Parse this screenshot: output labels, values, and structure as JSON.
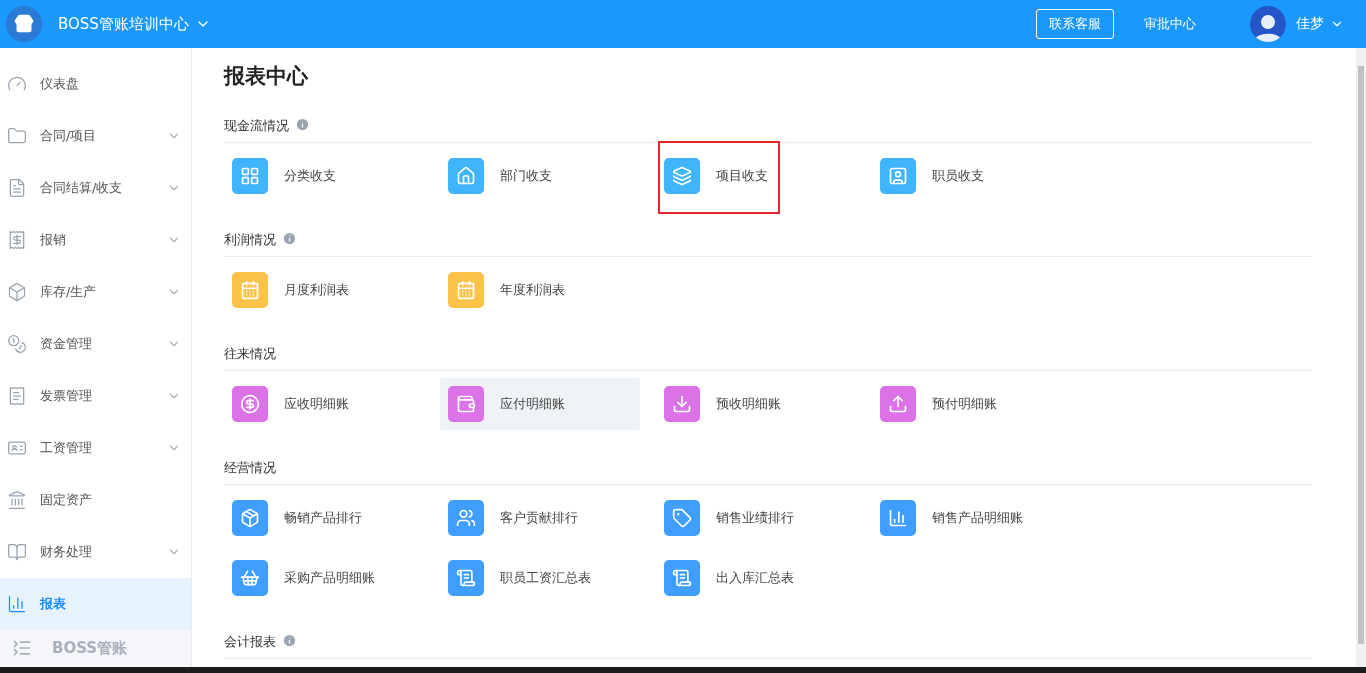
{
  "header": {
    "company": "BOSS管账培训中心",
    "support_button": "联系客服",
    "approval_link": "审批中心",
    "user_name": "佳梦"
  },
  "sidebar": {
    "items": [
      {
        "label": "仪表盘",
        "kind": "gauge",
        "expandable": false,
        "selected": false
      },
      {
        "label": "合同/项目",
        "kind": "folder",
        "expandable": true,
        "selected": false
      },
      {
        "label": "合同结算/收支",
        "kind": "settle",
        "expandable": true,
        "selected": false
      },
      {
        "label": "报销",
        "kind": "reimburse",
        "expandable": true,
        "selected": false
      },
      {
        "label": "库存/生产",
        "kind": "box",
        "expandable": true,
        "selected": false
      },
      {
        "label": "资金管理",
        "kind": "coins",
        "expandable": true,
        "selected": false
      },
      {
        "label": "发票管理",
        "kind": "receipt",
        "expandable": true,
        "selected": false
      },
      {
        "label": "工资管理",
        "kind": "card",
        "expandable": true,
        "selected": false
      },
      {
        "label": "固定资产",
        "kind": "asset",
        "expandable": false,
        "selected": false
      },
      {
        "label": "财务处理",
        "kind": "ledger",
        "expandable": true,
        "selected": false
      },
      {
        "label": "报表",
        "kind": "chart",
        "expandable": false,
        "selected": true
      }
    ],
    "footer": "BOSS管账"
  },
  "page": {
    "title": "报表中心",
    "sections": [
      {
        "heading": "现金流情况",
        "info": true,
        "color": "#40b5fc",
        "items": [
          {
            "label": "分类收支",
            "kind": "grid",
            "selected": false,
            "marked": false
          },
          {
            "label": "部门收支",
            "kind": "home",
            "selected": false,
            "marked": false
          },
          {
            "label": "项目收支",
            "kind": "layers",
            "selected": false,
            "marked": true
          },
          {
            "label": "职员收支",
            "kind": "person",
            "selected": false,
            "marked": false
          }
        ]
      },
      {
        "heading": "利润情况",
        "info": true,
        "color": "#fcc24a",
        "items": [
          {
            "label": "月度利润表",
            "kind": "calendar",
            "selected": false,
            "marked": false
          },
          {
            "label": "年度利润表",
            "kind": "calendar",
            "selected": false,
            "marked": false
          }
        ]
      },
      {
        "heading": "往来情况",
        "info": false,
        "color": "#db72e8",
        "items": [
          {
            "label": "应收明细账",
            "kind": "moneybag",
            "selected": false,
            "marked": false
          },
          {
            "label": "应付明细账",
            "kind": "wallet",
            "selected": true,
            "marked": false
          },
          {
            "label": "预收明细账",
            "kind": "download",
            "selected": false,
            "marked": false
          },
          {
            "label": "预付明细账",
            "kind": "upload",
            "selected": false,
            "marked": false
          }
        ]
      },
      {
        "heading": "经营情况",
        "info": false,
        "color": "#409eff",
        "items": [
          {
            "label": "畅销产品排行",
            "kind": "box",
            "selected": false,
            "marked": false
          },
          {
            "label": "客户贡献排行",
            "kind": "users",
            "selected": false,
            "marked": false
          },
          {
            "label": "销售业绩排行",
            "kind": "tag",
            "selected": false,
            "marked": false
          },
          {
            "label": "销售产品明细账",
            "kind": "bars",
            "selected": false,
            "marked": false
          },
          {
            "label": "采购产品明细账",
            "kind": "basket",
            "selected": false,
            "marked": false
          },
          {
            "label": "职员工资汇总表",
            "kind": "scroll",
            "selected": false,
            "marked": false
          },
          {
            "label": "出入库汇总表",
            "kind": "scroll",
            "selected": false,
            "marked": false
          }
        ]
      },
      {
        "heading": "会计报表",
        "info": true
      }
    ]
  }
}
